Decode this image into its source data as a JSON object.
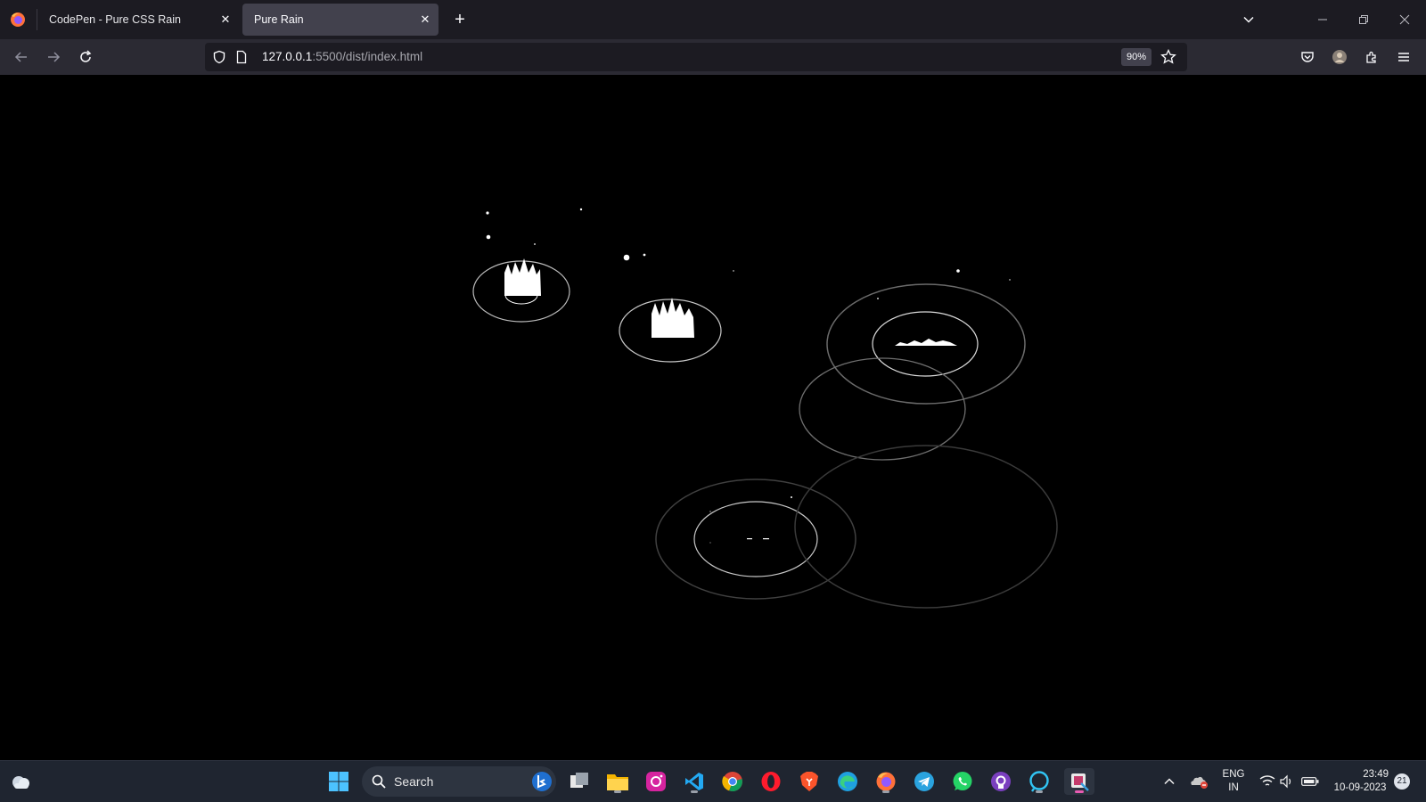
{
  "browser": {
    "tabs": [
      {
        "title": "CodePen - Pure CSS Rain",
        "active": false
      },
      {
        "title": "Pure Rain",
        "active": true
      }
    ],
    "url_host": "127.0.0.1",
    "url_path": ":5500/dist/index.html",
    "zoom": "90%"
  },
  "taskbar": {
    "search_label": "Search",
    "language_line1": "ENG",
    "language_line2": "IN",
    "time": "23:49",
    "date": "10-09-2023",
    "notification_count": "21"
  },
  "colors": {
    "tabbar_bg": "#1c1b22",
    "navbar_bg": "#2b2a33",
    "page_bg": "#000000",
    "taskbar_bg": "#1f2530"
  }
}
